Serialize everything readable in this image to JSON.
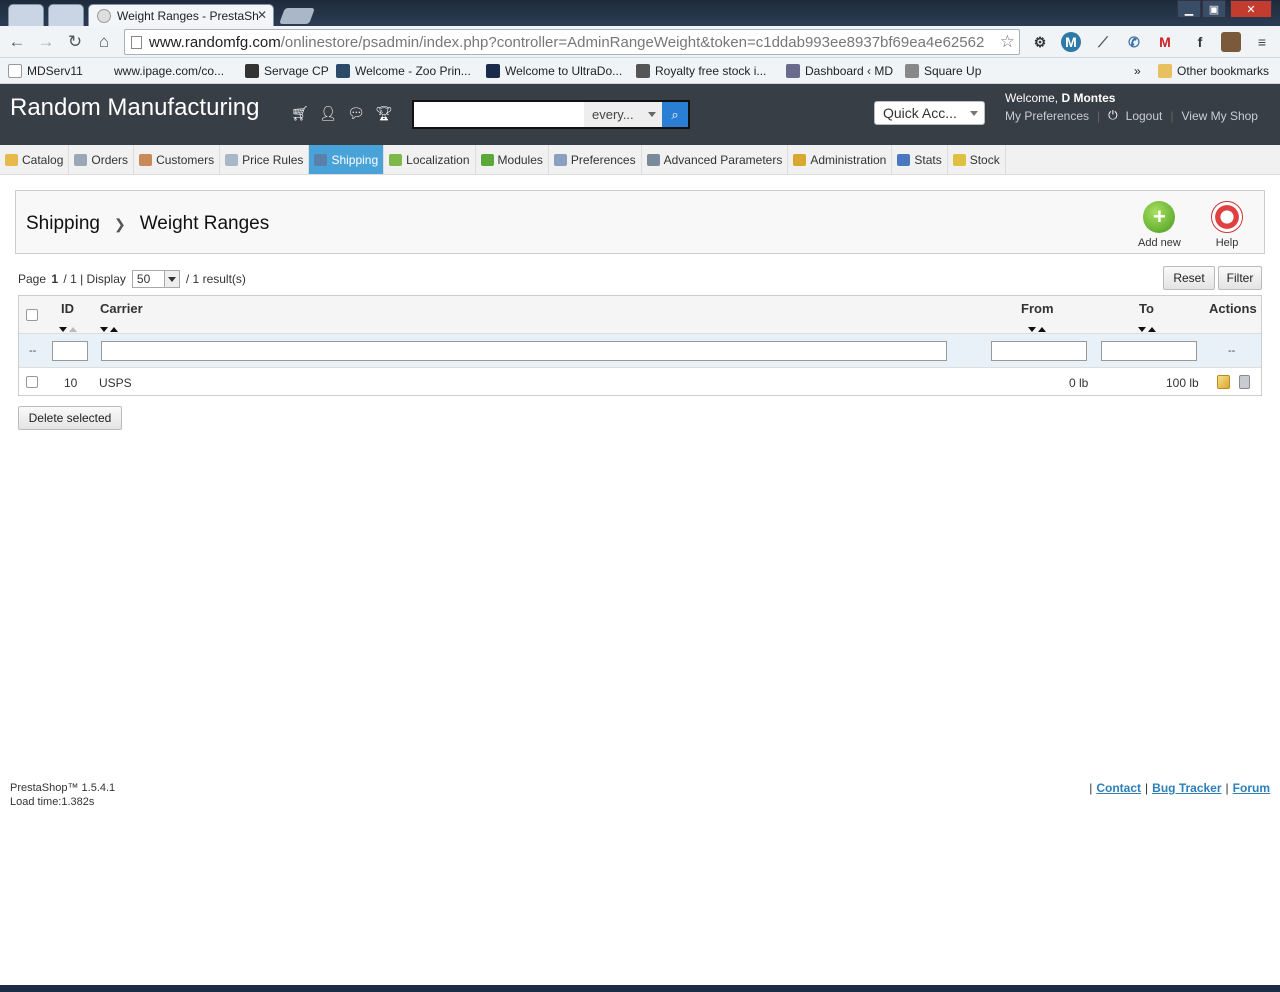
{
  "browser": {
    "active_tab_title": "Weight Ranges - PrestaSh",
    "url_host": "www.randomfg.com",
    "url_path": "/onlinestore/psadmin/index.php?controller=AdminRangeWeight&token=c1ddab993ee8937bf69ea4e62562",
    "bookmarks": [
      "MDServ11",
      "www.ipage.com/co...",
      "Servage CP",
      "Welcome - Zoo Prin...",
      "Welcome to UltraDo...",
      "Royalty free stock i...",
      "Dashboard ‹ MD",
      "Square Up"
    ],
    "bookmarks_overflow": "»",
    "other_bookmarks": "Other bookmarks"
  },
  "header": {
    "shop_name": "Random Manufacturing",
    "search_scope": "every...",
    "quick_access": "Quick Acc...",
    "welcome_prefix": "Welcome,",
    "user_name": "D Montes",
    "my_preferences": "My Preferences",
    "logout": "Logout",
    "view_shop": "View My Shop"
  },
  "menu": [
    {
      "label": "Catalog",
      "color": "#e7b84a"
    },
    {
      "label": "Orders",
      "color": "#9aa7b5"
    },
    {
      "label": "Customers",
      "color": "#c98a5a"
    },
    {
      "label": "Price Rules",
      "color": "#a8b8c8"
    },
    {
      "label": "Shipping",
      "color": "#5a7fa8",
      "active": true
    },
    {
      "label": "Localization",
      "color": "#7fb84a"
    },
    {
      "label": "Modules",
      "color": "#5aa83a"
    },
    {
      "label": "Preferences",
      "color": "#8aa0c0"
    },
    {
      "label": "Advanced Parameters",
      "color": "#7a8a9a"
    },
    {
      "label": "Administration",
      "color": "#d8a830"
    },
    {
      "label": "Stats",
      "color": "#4a78c0"
    },
    {
      "label": "Stock",
      "color": "#e0c040"
    }
  ],
  "breadcrumb": {
    "parent": "Shipping",
    "current": "Weight Ranges"
  },
  "toolbar": {
    "add_new": "Add new",
    "help": "Help"
  },
  "pagination": {
    "page_label": "Page",
    "page_current": "1",
    "page_total": "/ 1",
    "display_label": "| Display",
    "per_page": "50",
    "results": "/ 1 result(s)"
  },
  "buttons": {
    "reset": "Reset",
    "filter": "Filter",
    "delete_selected": "Delete selected"
  },
  "table": {
    "columns": {
      "id": "ID",
      "carrier": "Carrier",
      "from": "From",
      "to": "To",
      "actions": "Actions"
    },
    "filter_dash": "--",
    "rows": [
      {
        "id": "10",
        "carrier": "USPS",
        "from": "0 lb",
        "to": "100 lb"
      }
    ]
  },
  "footer": {
    "version": "PrestaShop™ 1.5.4.1",
    "load_time": "Load time:1.382s",
    "sep": "|",
    "contact": "Contact",
    "bug_tracker": "Bug Tracker",
    "forum": "Forum"
  }
}
